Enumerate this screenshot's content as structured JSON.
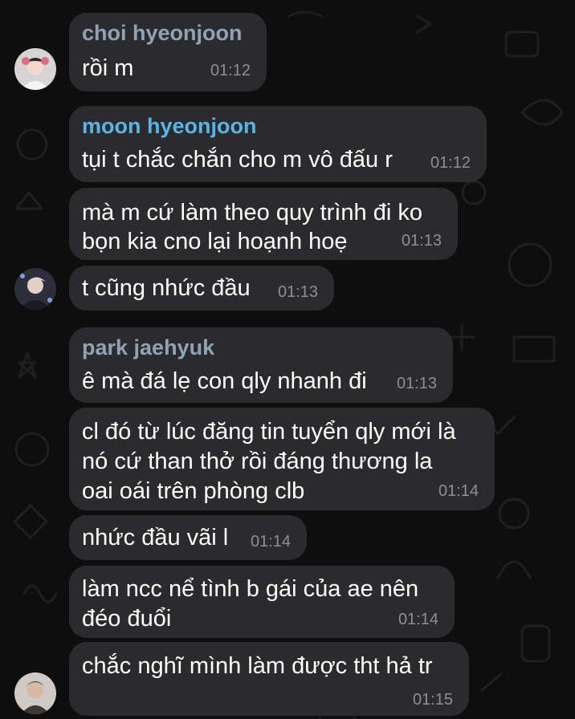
{
  "colors": {
    "background": "#0e0e0e",
    "bubble": "#2b2b2d",
    "text": "#ffffff",
    "time": "#8e8e93",
    "sender_choi": "#8fa3b5",
    "sender_moon": "#5ab4e8",
    "sender_park": "#8fa3b5"
  },
  "messages": [
    {
      "sender": "choi hyeonjoon",
      "lines": [
        "rồi m"
      ],
      "time": "01:12"
    },
    {
      "sender": "moon hyeonjoon",
      "lines": [
        "tụi t chắc chắn cho m vô đấu r"
      ],
      "time": "01:12"
    },
    {
      "lines": [
        "mà m cứ làm theo quy trình đi ko",
        "bọn kia cno lại hoạnh hoẹ"
      ],
      "time": "01:13"
    },
    {
      "lines": [
        "t cũng nhức đầu"
      ],
      "time": "01:13"
    },
    {
      "sender": "park jaehyuk",
      "lines": [
        "ê mà đá lẹ con qly nhanh đi"
      ],
      "time": "01:13"
    },
    {
      "lines": [
        "cl đó từ lúc đăng tin tuyển qly mới là",
        "nó cứ than thở rồi đáng thương la",
        "oai oái trên phòng clb"
      ],
      "time": "01:14"
    },
    {
      "lines": [
        "nhức đầu vãi l"
      ],
      "time": "01:14"
    },
    {
      "lines": [
        "làm ncc nể tình b gái của ae nên",
        "đéo đuổi"
      ],
      "time": "01:14"
    },
    {
      "lines": [
        "chắc nghĩ mình làm được tht hả tr"
      ],
      "time": "01:15"
    }
  ],
  "avatars": [
    "avatar-choi",
    "avatar-moon",
    "avatar-park"
  ]
}
